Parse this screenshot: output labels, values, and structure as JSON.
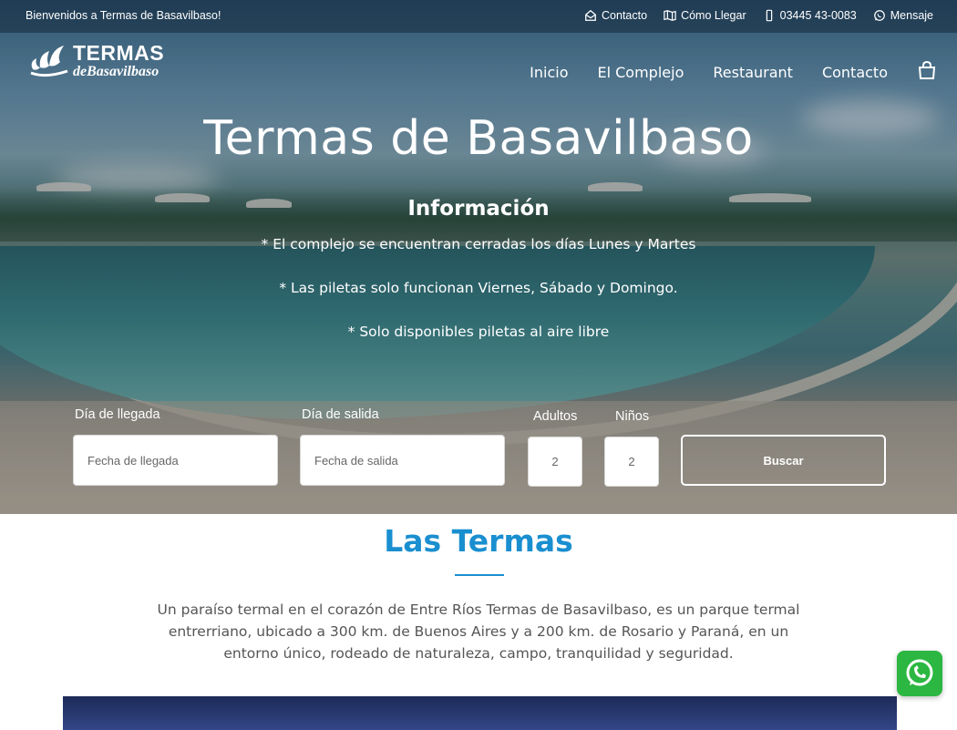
{
  "topbar": {
    "welcome": "Bienvenidos a Termas de Basavilbaso!",
    "links": {
      "contact": "Contacto",
      "directions": "Cómo Llegar",
      "phone": "03445 43-0083",
      "message": "Mensaje"
    }
  },
  "logo": {
    "top": "TERMAS",
    "bottom": "deBasavilbaso"
  },
  "nav": {
    "home": "Inicio",
    "complex": "El Complejo",
    "restaurant": "Restaurant",
    "contact": "Contacto"
  },
  "hero": {
    "title": "Termas de Basavilbaso",
    "info_title": "Información",
    "info_lines": [
      "* El complejo se encuentran cerradas los días Lunes y Martes",
      "* Las piletas solo funcionan Viernes, Sábado y Domingo.",
      "* Solo disponibles piletas al aire libre"
    ]
  },
  "booking": {
    "arrival_label": "Día de llegada",
    "arrival_placeholder": "Fecha de llegada",
    "departure_label": "Día de salida",
    "departure_placeholder": "Fecha de salida",
    "adults_label": "Adultos",
    "adults_value": "2",
    "children_label": "Niños",
    "children_value": "2",
    "search_label": "Buscar"
  },
  "section": {
    "title": "Las Termas",
    "text": "Un paraíso termal en el corazón de Entre Ríos Termas de Basavilbaso, es un parque termal entrerriano, ubicado a 300 km. de Buenos Aires y a 200 km. de Rosario y Paraná, en un entorno único, rodeado de naturaleza, campo, tranquilidad y seguridad."
  },
  "colors": {
    "accent": "#1a8fd0",
    "whatsapp": "#2bb741",
    "text": "#555555"
  },
  "icons": [
    "envelope-open-icon",
    "map-icon",
    "phone-icon",
    "whatsapp-icon",
    "cart-icon"
  ]
}
